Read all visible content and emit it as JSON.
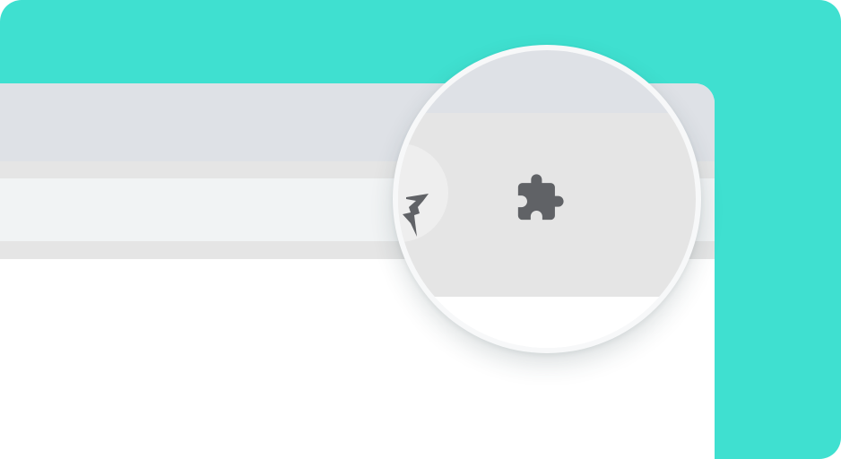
{
  "theme": {
    "background": "#3fe0d0",
    "tabstrip": "#dee1e6",
    "toolbar": "#e5e5e5",
    "omnibox": "#f1f3f4",
    "icon": "#606266"
  },
  "toolbar": {
    "extensions_icon": "puzzle-icon",
    "previous_extension_icon": "extension-logo-icon"
  }
}
